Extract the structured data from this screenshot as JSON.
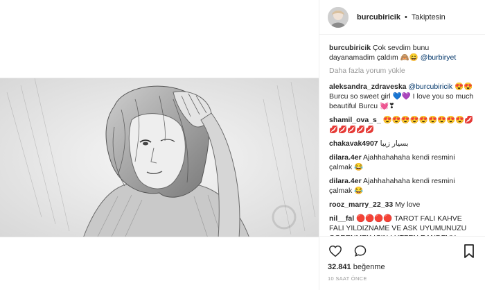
{
  "header": {
    "username": "burcubiricik",
    "separator": "•",
    "follow_status": "Takiptesin"
  },
  "caption": {
    "username": "burcubiricik",
    "text": "Çok sevdim bunu dayanamadim çaldım 🙈😄",
    "mention": "@burbiryet"
  },
  "load_more": "Daha fazla yorum yükle",
  "comments": [
    {
      "user": "aleksandra_zdraveska",
      "mention": "@burcubiricik",
      "text": "😍😍 Burcu so sweet girl 💙💜 I love you so much beautiful Burcu 💓❣"
    },
    {
      "user": "shamil_ova_s_",
      "mention": "",
      "text": "😍😍😍😍😍😍😍😍😍💋💋💋💋💋💋"
    },
    {
      "user": "chakavak4907",
      "mention": "",
      "text": "بسیار زیبا"
    },
    {
      "user": "dilara.4er",
      "mention": "",
      "text": "Ajahhahahaha kendi resmini çalmak 😂"
    },
    {
      "user": "dilara.4er",
      "mention": "",
      "text": "Ajahhahahaha kendi resmini çalmak 😂"
    },
    {
      "user": "rooz_marry_22_33",
      "mention": "",
      "text": "My love"
    },
    {
      "user": "nil__fal",
      "mention": "",
      "text": "🔴🔴🔴🔴 TAROT FALI KAHVE FALI YILDIZNAME VE ASK UYUMUNUZU OGRENMEK ICIN LUTFEN RANDEVU ALINIZ 🔴🔴🔴🔴"
    }
  ],
  "likes": {
    "count": "32.841",
    "label": "beğenme"
  },
  "time": "10 SAAT ÖNCE",
  "icons": {
    "like": "heart-icon",
    "comment": "comment-icon",
    "save": "bookmark-icon"
  }
}
